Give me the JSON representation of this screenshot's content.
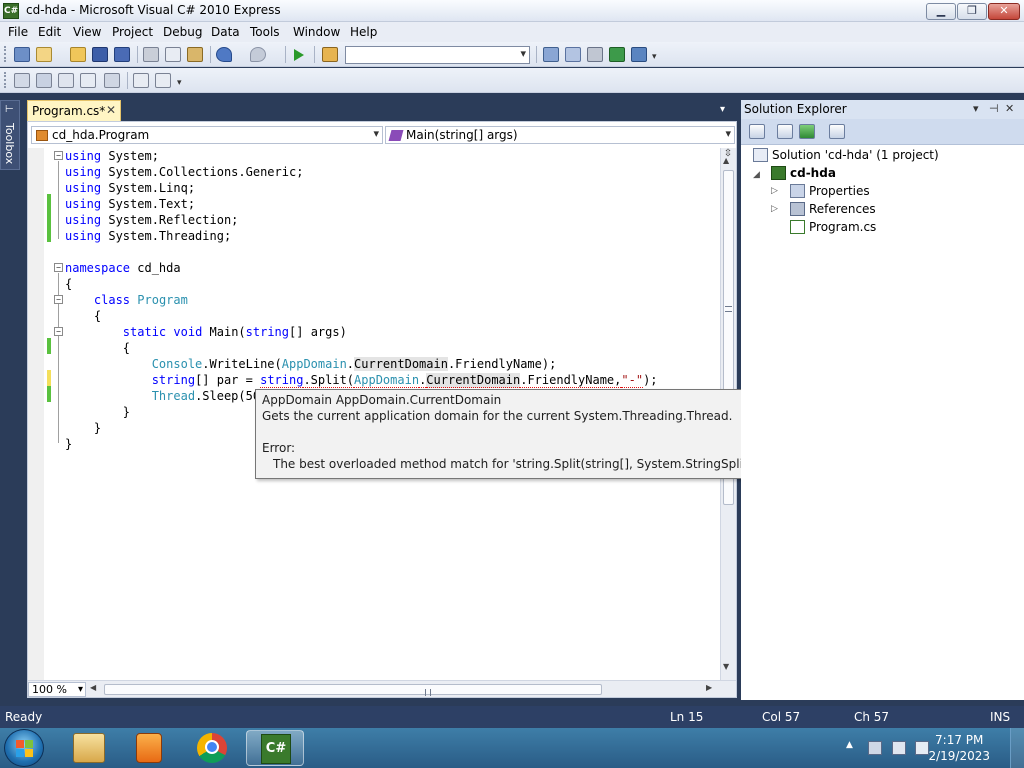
{
  "window": {
    "title": "cd-hda - Microsoft Visual C# 2010 Express",
    "minimize": "▁",
    "maximize": "❐",
    "close": "✕"
  },
  "menu": [
    "File",
    "Edit",
    "View",
    "Project",
    "Debug",
    "Data",
    "Tools",
    "Window",
    "Help"
  ],
  "toolbar": {
    "solution_config": ""
  },
  "toolbox": {
    "label": "Toolbox",
    "pin": "⊢"
  },
  "editor": {
    "tab_label": "Program.cs*",
    "tab_close": "✕",
    "tab_menu": "▾",
    "nav_type": "cd_hda.Program",
    "nav_member": "Main(string[] args)",
    "zoom": "100 %",
    "split": "⇳"
  },
  "code": {
    "l1": [
      "using",
      " System;"
    ],
    "l2": [
      "using",
      " System.Collections.Generic;"
    ],
    "l3": [
      "using",
      " System.Linq;"
    ],
    "l4": [
      "using",
      " System.Text;"
    ],
    "l5": [
      "using",
      " System.Reflection;"
    ],
    "l6": [
      "using",
      " System.Threading;"
    ],
    "l8": [
      "namespace",
      " cd_hda"
    ],
    "l9": "{",
    "l10": [
      "    ",
      "class",
      " ",
      "Program"
    ],
    "l11": "    {",
    "l12": [
      "        ",
      "static",
      " ",
      "void",
      " Main(",
      "string",
      "[] args)"
    ],
    "l13": "        {",
    "l14": [
      "            ",
      "Console",
      ".WriteLine(",
      "AppDomain",
      ".",
      "CurrentDomain",
      ".FriendlyName);"
    ],
    "l15": [
      "            ",
      "string",
      "[] par = ",
      "string",
      ".Split(",
      "AppDomain",
      ".",
      "CurrentDomain",
      ".FriendlyName,",
      "\"-\"",
      ");"
    ],
    "l16": [
      "            ",
      "Thread",
      ".Sleep(50"
    ],
    "l17": "        }",
    "l18": "    }",
    "l19": "}"
  },
  "tooltip": {
    "signature": "AppDomain AppDomain.CurrentDomain",
    "description": "Gets the current application domain for the current System.Threading.Thread.",
    "error_label": "Error:",
    "error_message": "The best overloaded method match for 'string.Split(string[], System.StringSplitOptions)' has some invalid arguments"
  },
  "solution_explorer": {
    "title": "Solution Explorer",
    "controls": [
      "▾",
      "⊣",
      "✕"
    ],
    "solution": "Solution 'cd-hda' (1 project)",
    "project": "cd-hda",
    "items": [
      "Properties",
      "References",
      "Program.cs"
    ],
    "expander": "▷",
    "project_expander": "◢"
  },
  "status": {
    "ready": "Ready",
    "line": "Ln 15",
    "col": "Col 57",
    "ch": "Ch 57",
    "mode": "INS"
  },
  "taskbar": {
    "time": "7:17 PM",
    "date": "2/19/2023",
    "vs_label": "C#"
  },
  "colors": {
    "keyword": "#0000ff",
    "type": "#2b91af",
    "string": "#a31515",
    "status_bar": "#2d4065",
    "change_saved": "#5ac13f",
    "change_unsaved": "#f4df5b"
  }
}
